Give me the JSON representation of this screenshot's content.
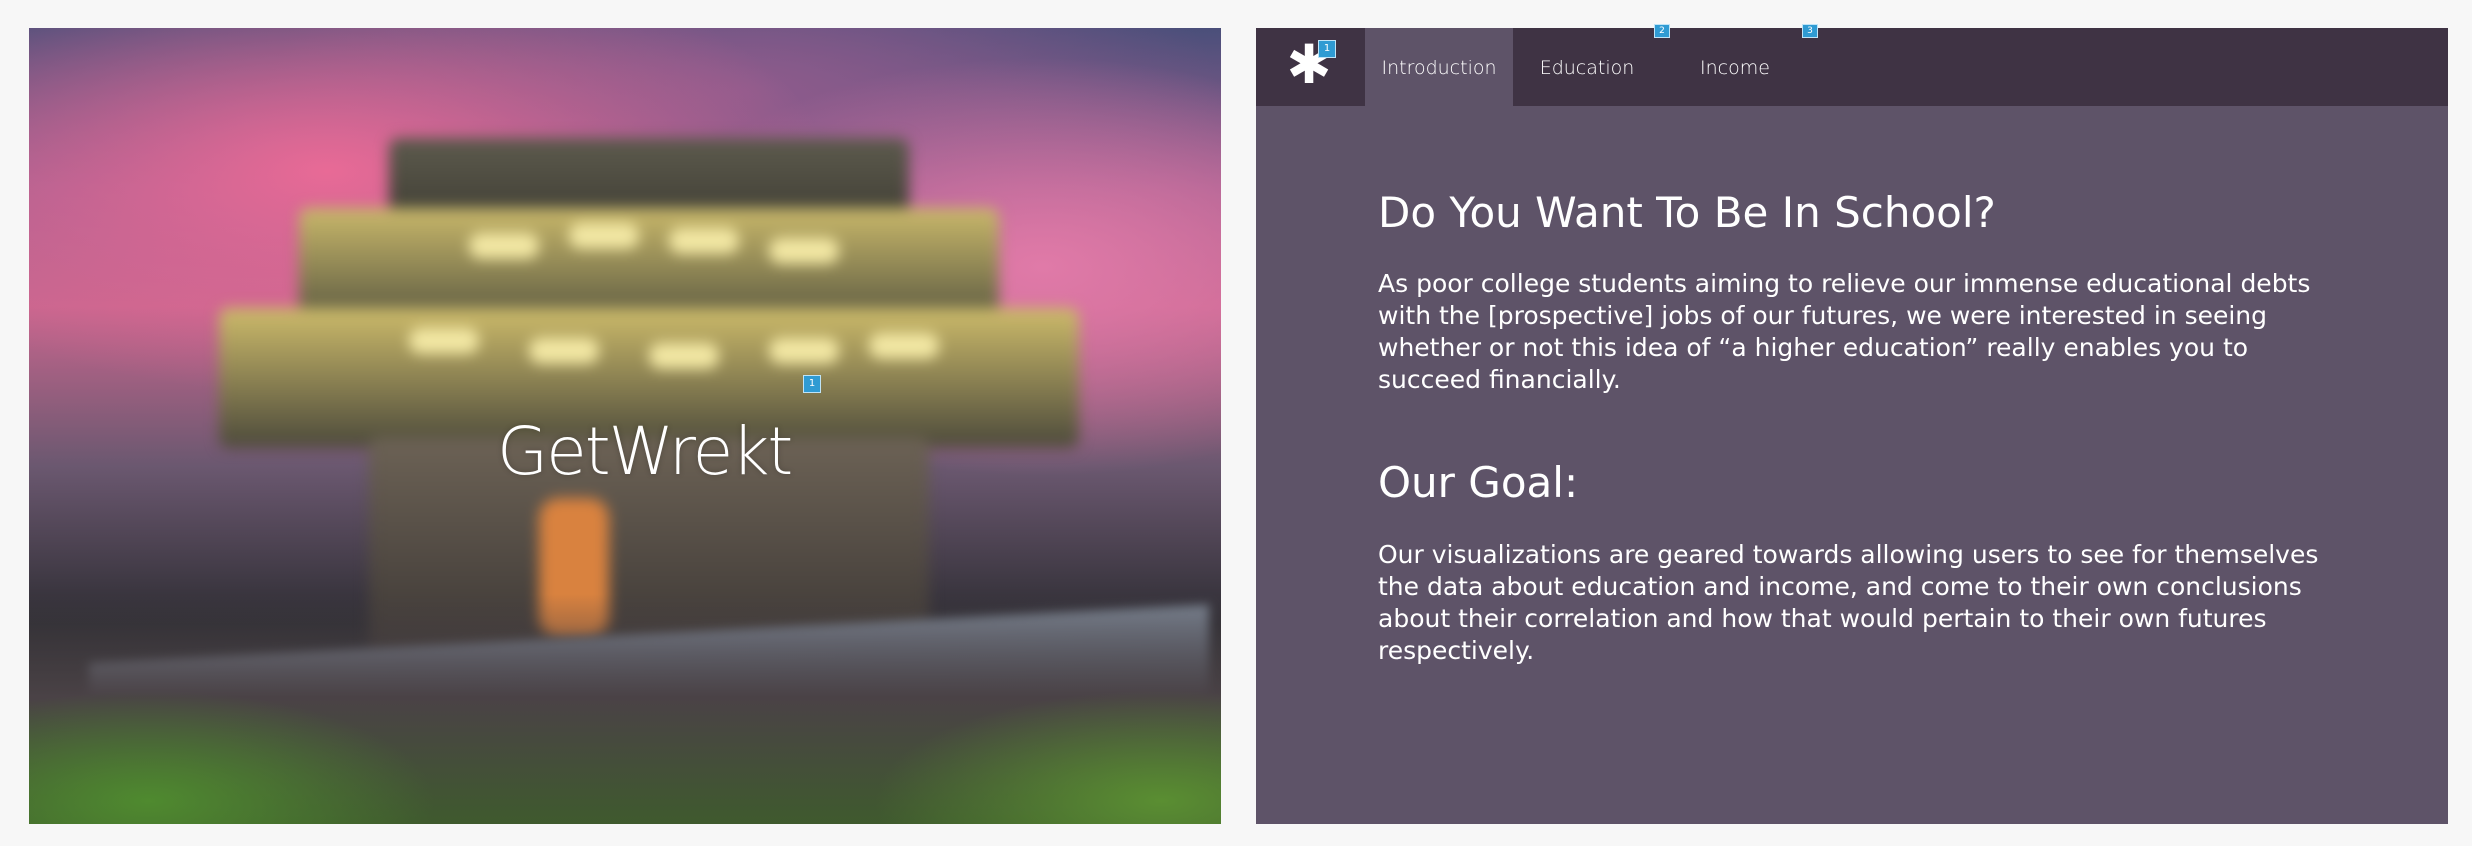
{
  "hero": {
    "title": "GetWrekt",
    "marker_label": "1"
  },
  "nav": {
    "logo_icon": "asterisk-icon",
    "logo_marker": "1",
    "tabs": [
      {
        "label": "Introduction",
        "active": true
      },
      {
        "label": "Education",
        "active": false,
        "marker": "2"
      },
      {
        "label": "Income",
        "active": false,
        "marker": "3"
      }
    ]
  },
  "main": {
    "heading": "Do You Want To Be In School?",
    "intro": "As poor college students aiming to relieve our immense educational debts with the [prospective] jobs of our futures, we were interested in seeing whether or not this idea of “a higher education” really enables you to succeed financially.",
    "goal_heading": "Our Goal:",
    "goal_text": "Our visualizations are geared towards allowing users to see for themselves the data about education and income, and come to their own conclusions about their correlation and how that would pertain to their own futures respectively."
  },
  "colors": {
    "panel_bg": "#5e5368",
    "navbar_bg": "#3f3344",
    "marker": "#2f9bd3"
  }
}
